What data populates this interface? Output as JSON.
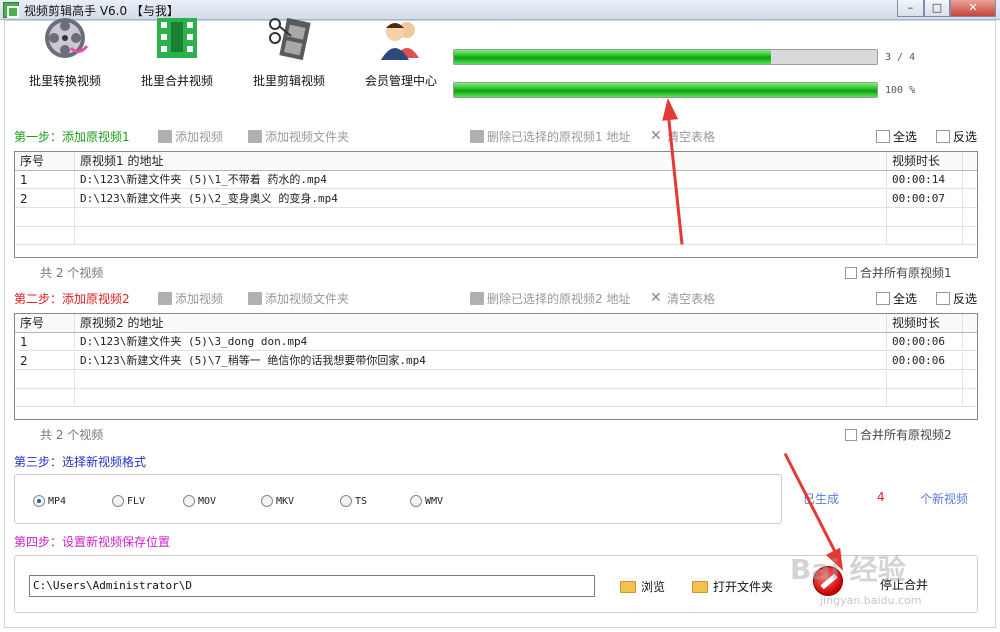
{
  "window": {
    "title": "视频剪辑高手 V6.0 【与我】",
    "minimize": "–",
    "maximize": "□",
    "close": "✕"
  },
  "toolbar": [
    {
      "label": "批里转换视频",
      "icon": "film-reel-icon"
    },
    {
      "label": "批里合并视频",
      "icon": "film-strip-icon"
    },
    {
      "label": "批里剪辑视频",
      "icon": "scissors-film-icon"
    },
    {
      "label": "会员管理中心",
      "icon": "members-icon"
    }
  ],
  "progress": [
    {
      "text": "3 / 4",
      "fraction": 0.75
    },
    {
      "text": "100 %",
      "fraction": 1.0
    }
  ],
  "step1": {
    "label": "第一步：添加原视频1",
    "add_video": "添加视频",
    "add_folder": "添加视频文件夹",
    "delete": "删除已选择的原视频1 地址",
    "clear": "清空表格",
    "select_all": "全选",
    "invert": "反选",
    "columns": [
      "序号",
      "原视频1 的地址",
      "视频时长"
    ],
    "rows": [
      [
        "1",
        "D:\\123\\新建文件夹 (5)\\1_不带着 药水的.mp4",
        "00:00:14"
      ],
      [
        "2",
        "D:\\123\\新建文件夹 (5)\\2_变身奥义 的变身.mp4",
        "00:00:07"
      ]
    ],
    "count": "共 2 个视频",
    "merge_all": "合并所有原视频1"
  },
  "step2": {
    "label": "第二步：添加原视频2",
    "add_video": "添加视频",
    "add_folder": "添加视频文件夹",
    "delete": "删除已选择的原视频2 地址",
    "clear": "清空表格",
    "select_all": "全选",
    "invert": "反选",
    "columns": [
      "序号",
      "原视频2 的地址",
      "视频时长"
    ],
    "rows": [
      [
        "1",
        "D:\\123\\新建文件夹 (5)\\3_dong don.mp4",
        "00:00:06"
      ],
      [
        "2",
        "D:\\123\\新建文件夹 (5)\\7_稍等一 绝信你的话我想要带你回家.mp4",
        "00:00:06"
      ]
    ],
    "count": "共 2 个视频",
    "merge_all": "合并所有原视频2"
  },
  "step3": {
    "label": "第三步：选择新视频格式",
    "formats": [
      "MP4",
      "FLV",
      "MOV",
      "MKV",
      "TS",
      "WMV"
    ],
    "selected": "MP4",
    "generated_prefix": "已生成",
    "generated_count": "4",
    "generated_suffix": "个新视频"
  },
  "step4": {
    "label": "第四步：设置新视频保存位置",
    "path": "C:\\Users\\Administrator\\D",
    "browse": "浏览",
    "open_folder": "打开文件夹",
    "stop": "停止合并"
  },
  "watermark": {
    "logo": "Bai 经验",
    "url": "jingyan.baidu.com"
  },
  "colors": {
    "step1": "#1a9c1a",
    "step2": "#e02020",
    "step3": "#2433c8",
    "step4": "#cc22cc",
    "progress": "#18b018",
    "annotation": "#e53935"
  }
}
